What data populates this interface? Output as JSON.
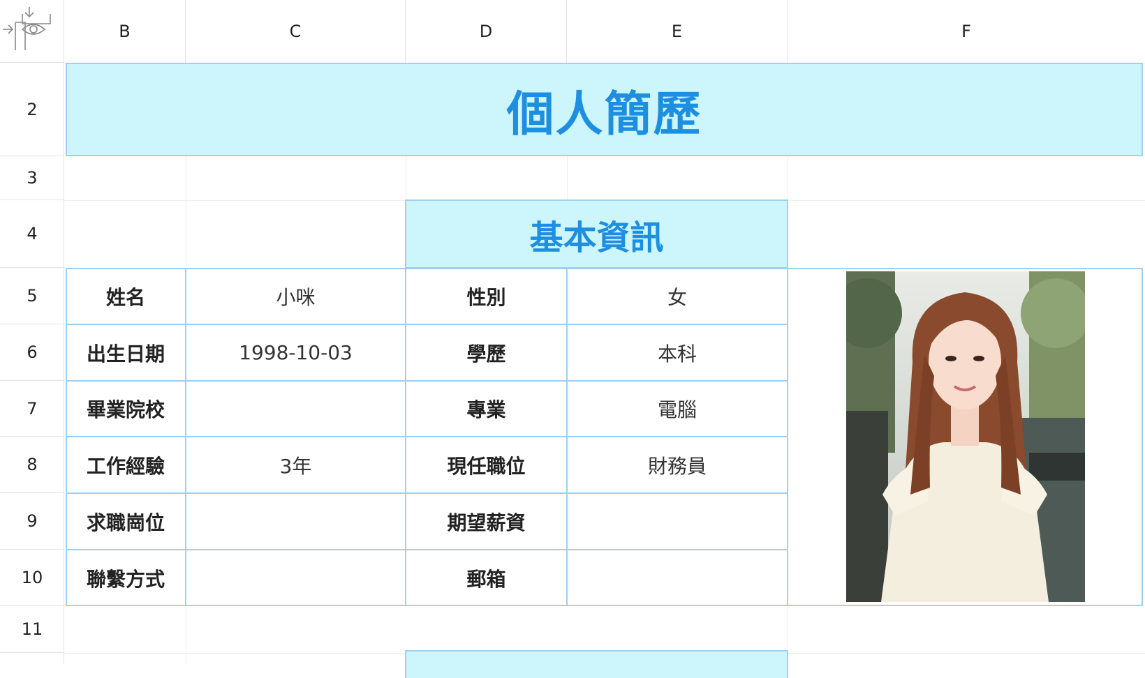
{
  "columns": [
    "B",
    "C",
    "D",
    "E",
    "F"
  ],
  "rows": [
    "2",
    "3",
    "4",
    "5",
    "6",
    "7",
    "8",
    "9",
    "10",
    "11"
  ],
  "title": "個人簡歷",
  "section_title": "基本資訊",
  "info": {
    "name_label": "姓名",
    "name_value": "小咪",
    "gender_label": "性別",
    "gender_value": "女",
    "birth_label": "出生日期",
    "birth_value": "1998-10-03",
    "education_label": "學歷",
    "education_value": "本科",
    "school_label": "畢業院校",
    "school_value": "",
    "major_label": "專業",
    "major_value": "電腦",
    "experience_label": "工作經驗",
    "experience_value": "3年",
    "position_label": "現任職位",
    "position_value": "財務員",
    "target_label": "求職崗位",
    "target_value": "",
    "salary_label": "期望薪資",
    "salary_value": "",
    "contact_label": "聯繫方式",
    "contact_value": "",
    "email_label": "郵箱",
    "email_value": ""
  },
  "colors": {
    "band_bg": "#ccf6fc",
    "band_border": "#9dd0f2",
    "title_text": "#1e8fe0"
  },
  "icons": [
    "freeze-panes-icon",
    "eye-icon"
  ]
}
